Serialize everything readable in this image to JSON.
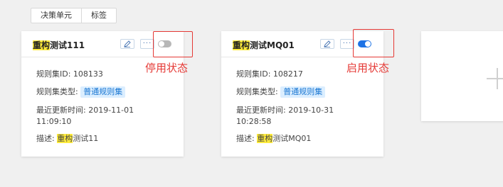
{
  "tabs": [
    "决策单元",
    "标签"
  ],
  "cards": [
    {
      "title_hl": "重构",
      "title_rest": "测试111",
      "enabled": false,
      "id_label": "规则集ID:",
      "id_value": "108133",
      "type_label": "规则集类型:",
      "type_value": "普通规则集",
      "updated_label": "最近更新时间:",
      "updated_date": "2019-11-01",
      "updated_time": "11:09:10",
      "desc_label": "描述:",
      "desc_hl": "重构",
      "desc_rest": "测试11",
      "annotation": "停用状态"
    },
    {
      "title_hl": "重构",
      "title_rest": "测试MQ01",
      "enabled": true,
      "id_label": "规则集ID:",
      "id_value": "108217",
      "type_label": "规则集类型:",
      "type_value": "普通规则集",
      "updated_label": "最近更新时间:",
      "updated_date": "2019-10-31",
      "updated_time": "10:28:58",
      "desc_label": "描述:",
      "desc_hl": "重构",
      "desc_rest": "测试MQ01",
      "annotation": "启用状态"
    }
  ],
  "icons": {
    "edit": "pencil-icon",
    "more": "ellipsis-icon",
    "add": "plus-icon"
  },
  "colors": {
    "highlight": "#ffeb3b",
    "toggle_on": "#1e73e5",
    "toggle_off": "#b7b7b7",
    "annotation": "#e53935",
    "tag_text": "#1976d2"
  }
}
